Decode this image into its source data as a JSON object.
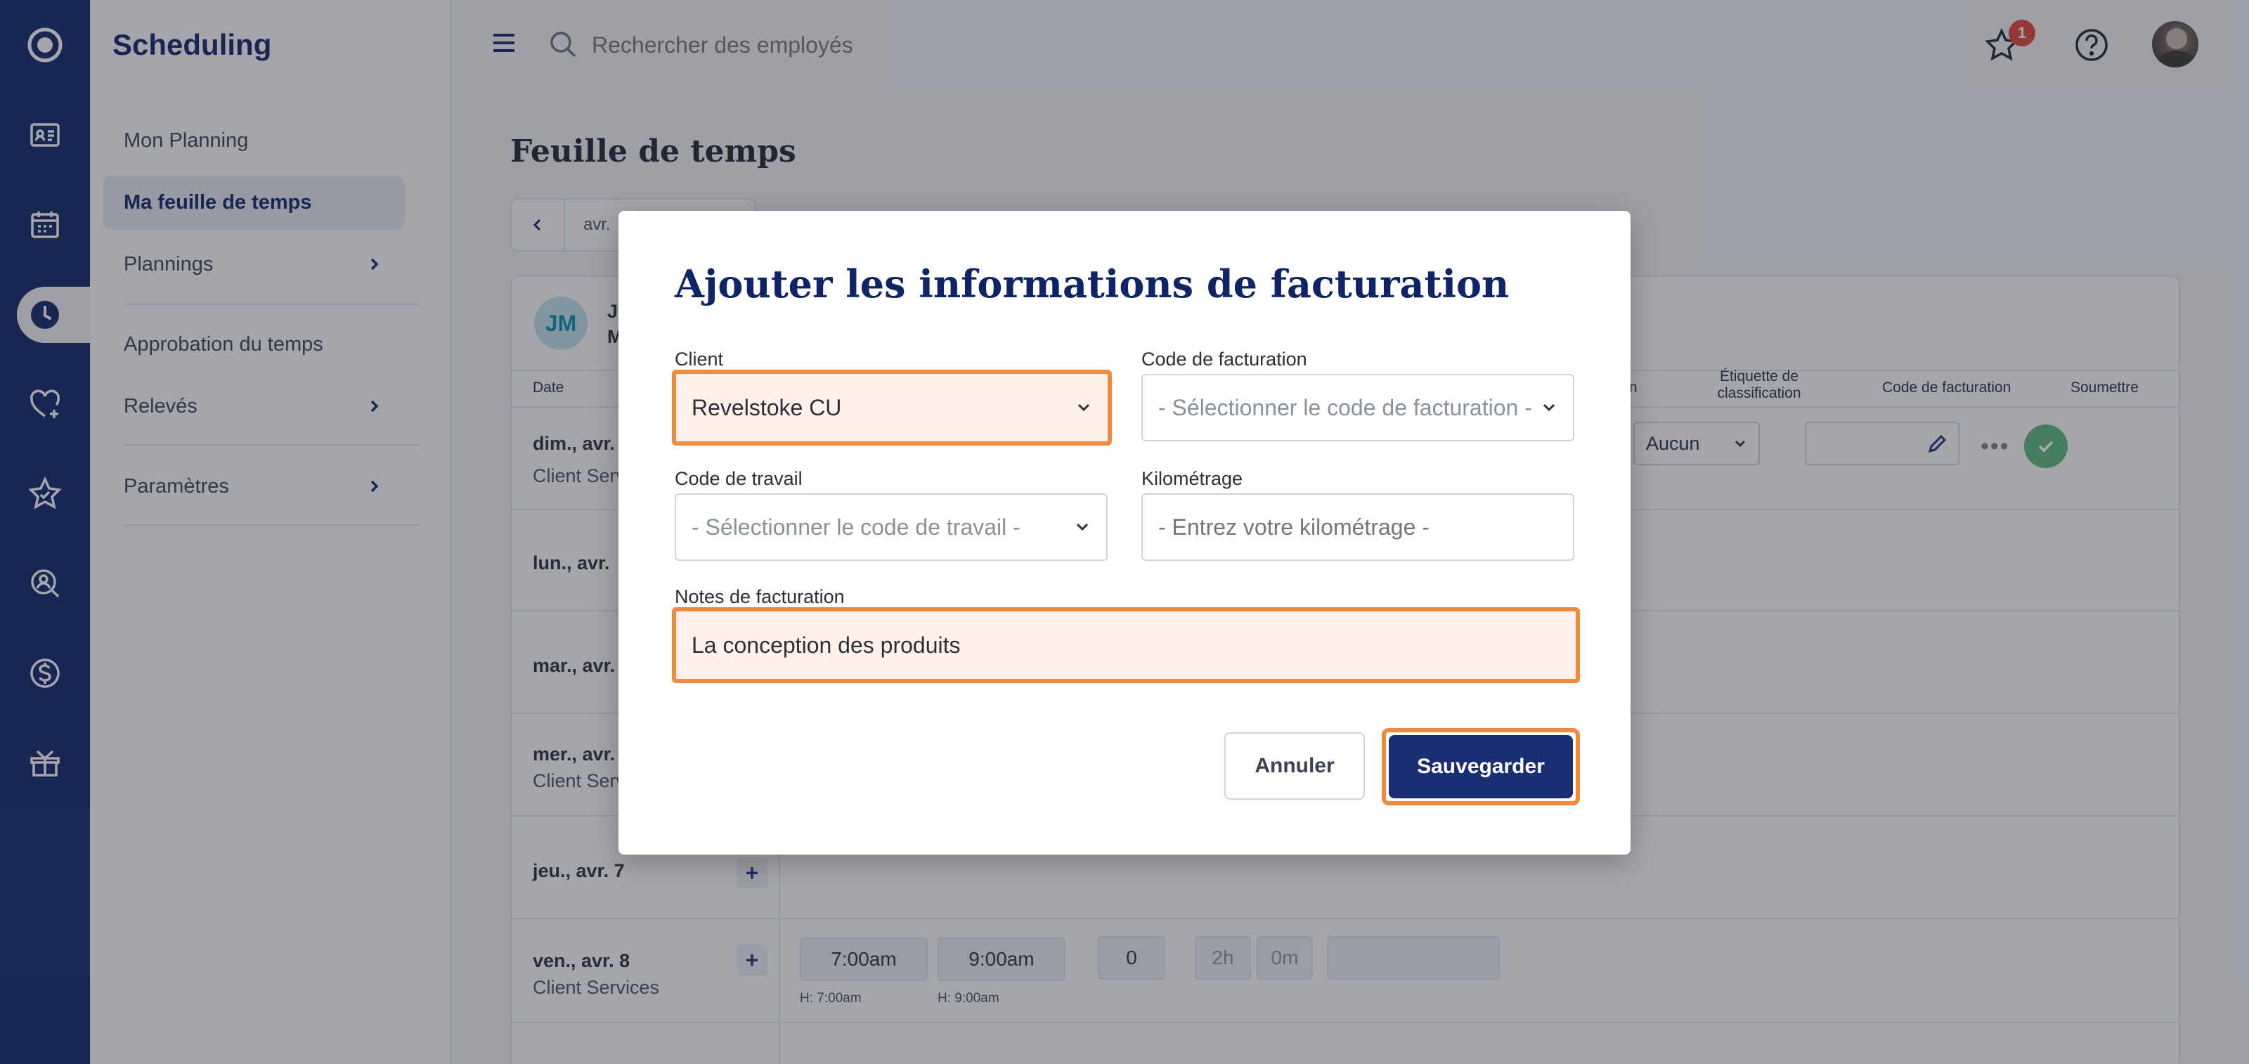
{
  "app": {
    "title": "Scheduling"
  },
  "search": {
    "placeholder": "Rechercher des employés"
  },
  "notifications": {
    "count": "1"
  },
  "sidebar": {
    "items": [
      {
        "label": "Mon Planning"
      },
      {
        "label": "Ma feuille de temps"
      },
      {
        "label": "Plannings"
      },
      {
        "label": "Approbation du temps"
      },
      {
        "label": "Relevés"
      },
      {
        "label": "Paramètres"
      }
    ]
  },
  "page": {
    "title": "Feuille de temps",
    "week_label": "avr.",
    "employee_initials": "JM",
    "employee_name_partial": "Jo",
    "employee_sub_partial": "M"
  },
  "table": {
    "headers": {
      "date": "Date",
      "classification": "Étiquette de classification",
      "billing_code": "Code de facturation",
      "submit": "Soumettre",
      "partial": "n"
    },
    "classification_value": "Aucun",
    "rows": [
      {
        "day": "dim., avr.",
        "dept": "Client Serv"
      },
      {
        "day": "lun., avr.",
        "dept": ""
      },
      {
        "day": "mar., avr.",
        "dept": ""
      },
      {
        "day": "mer., avr.",
        "dept": "Client Serv"
      },
      {
        "day": "jeu., avr. 7",
        "dept": ""
      },
      {
        "day": "ven., avr. 8",
        "dept": "Client Services"
      }
    ],
    "friday": {
      "start": "7:00am",
      "end": "9:00am",
      "break": "0",
      "hours": "2h",
      "minutes": "0m",
      "hint_start": "H: 7:00am",
      "hint_end": "H: 9:00am"
    }
  },
  "modal": {
    "title": "Ajouter les informations de facturation",
    "client_label": "Client",
    "client_value": "Revelstoke CU",
    "billing_code_label": "Code de facturation",
    "billing_code_placeholder": "- Sélectionner le code de facturation -",
    "work_code_label": "Code de travail",
    "work_code_placeholder": "- Sélectionner le code de travail -",
    "mileage_label": "Kilométrage",
    "mileage_placeholder": "- Entrez votre kilométrage -",
    "notes_label": "Notes de facturation",
    "notes_value": "La conception des produits",
    "cancel_label": "Annuler",
    "save_label": "Sauvegarder"
  },
  "colors": {
    "rail": "#0d2466",
    "primary": "#1a2f73",
    "highlight": "#f08a3c",
    "success": "#5cb87a",
    "badge": "#e0453a"
  }
}
